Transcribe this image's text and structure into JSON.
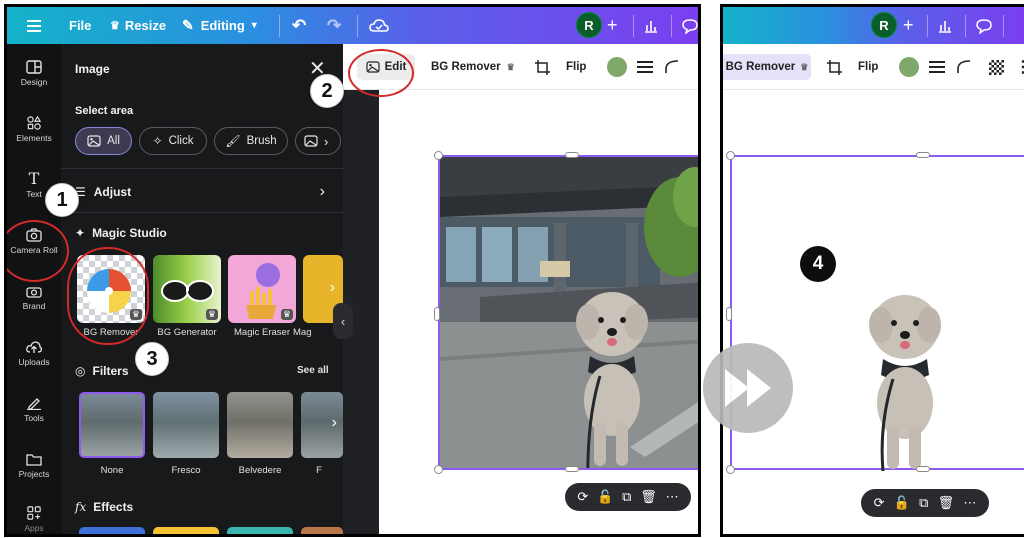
{
  "topbar": {
    "file_label": "File",
    "resize_label": "Resize",
    "editing_label": "Editing",
    "avatar_letter": "R"
  },
  "rail": [
    {
      "label": "Design",
      "icon": "layout-icon"
    },
    {
      "label": "Elements",
      "icon": "shapes-icon"
    },
    {
      "label": "Text",
      "icon": "text-icon"
    },
    {
      "label": "Camera Roll",
      "icon": "camera-icon"
    },
    {
      "label": "Brand",
      "icon": "brand-icon"
    },
    {
      "label": "Uploads",
      "icon": "upload-icon"
    },
    {
      "label": "Tools",
      "icon": "pen-icon"
    },
    {
      "label": "Projects",
      "icon": "folder-icon"
    },
    {
      "label": "Apps",
      "icon": "apps-icon"
    }
  ],
  "panel": {
    "title": "Image",
    "select_area_label": "Select area",
    "select_options": [
      "All",
      "Click",
      "Brush"
    ],
    "adjust_label": "Adjust",
    "magic_studio_label": "Magic Studio",
    "magic_tools": [
      "BG Remover",
      "BG Generator",
      "Magic Eraser",
      "Mag"
    ],
    "filters_label": "Filters",
    "see_all_label": "See all",
    "filters": [
      "None",
      "Fresco",
      "Belvedere",
      "F"
    ],
    "effects_label": "Effects"
  },
  "ctx_bar": {
    "edit_label": "Edit",
    "bg_remover_label": "BG Remover",
    "flip_label": "Flip"
  },
  "right_ctx_bar": {
    "bg_remover_label": "BG Remover",
    "flip_label": "Flip"
  },
  "steps": [
    "1",
    "2",
    "3",
    "4"
  ],
  "colors": {
    "accent_purple": "#8d5bf0",
    "highlight_red": "#d32a2a",
    "panel_bg": "#18191b",
    "avatar_green": "#0b5e2b",
    "swatch_green": "#7fa86a"
  }
}
